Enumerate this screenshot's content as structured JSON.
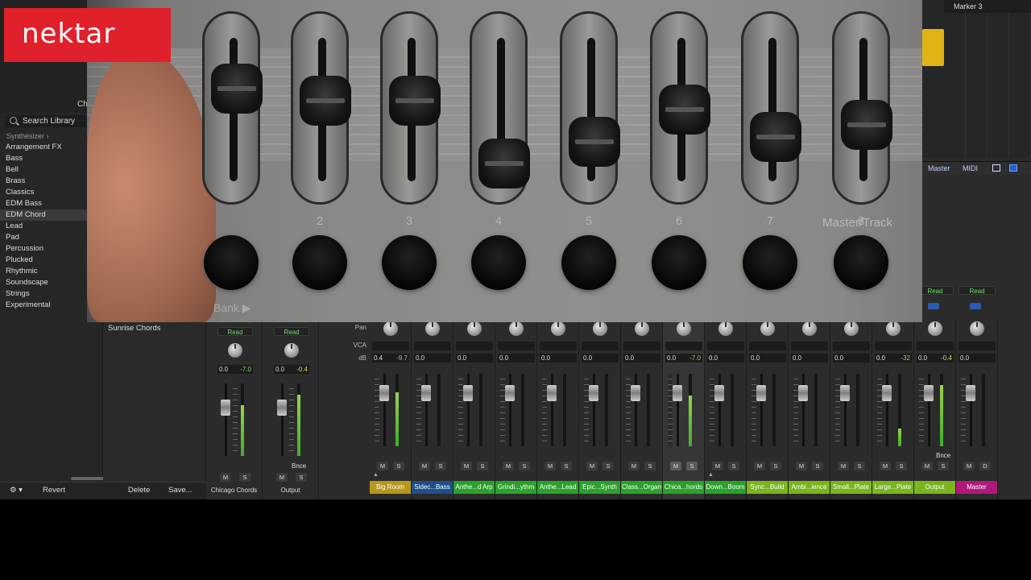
{
  "brand": {
    "logo_text": "nektar",
    "color": "#e0202a"
  },
  "library": {
    "title_clip": "Chi",
    "search_placeholder": "Search Library",
    "breadcrumb": "Synthesizer",
    "items": [
      "Arrangement FX",
      "Bass",
      "Bell",
      "Brass",
      "Classics",
      "EDM Bass",
      "EDM Chord",
      "Lead",
      "Pad",
      "Percussion",
      "Plucked",
      "Rhythmic",
      "Soundscape",
      "Strings",
      "Experimental"
    ],
    "selected": "EDM Chord",
    "footer": {
      "revert": "Revert",
      "delete": "Delete",
      "save": "Save..."
    }
  },
  "patches": {
    "current": "Sunrise Chords"
  },
  "tracks": {
    "marker": "Marker 3"
  },
  "mixer_toolbar": {
    "master": "Master",
    "midi": "MIDI"
  },
  "hardware": {
    "fader_numbers": [
      "2",
      "3",
      "4",
      "5",
      "6",
      "7",
      "8"
    ],
    "master_label": "Master/Track",
    "bank_label": "Bank ▶",
    "fader_levels": [
      0.72,
      0.62,
      0.62,
      0.1,
      0.28,
      0.55,
      0.32,
      0.42
    ]
  },
  "mixer": {
    "row_labels": {
      "pan": "Pan",
      "vca": "VCA",
      "db": "dB"
    },
    "left_strips": [
      {
        "name": "Chicago Chords",
        "auto": "Read",
        "vol": "0.0",
        "peak": "-7.0",
        "peak_kind": "hot",
        "m": "M",
        "s": "S",
        "meter": 0.7
      },
      {
        "name": "Output",
        "auto": "Read",
        "vol": "0.0",
        "peak": "-0.4",
        "peak_kind": "warn",
        "m": "M",
        "s": "S",
        "bnce": "Bnce",
        "meter": 0.85
      }
    ],
    "strips": [
      {
        "name": "Big Room",
        "color": "#b8971a",
        "vol": "0.4",
        "peak": "-9.7",
        "peak_kind": "hot",
        "meter": 0.75
      },
      {
        "name": "Sidec...Bass",
        "color": "#1f4f8a",
        "vol": "0.0",
        "peak": "",
        "peak_kind": "",
        "meter": 0
      },
      {
        "name": "Anthe...d Arp",
        "color": "#2aa12a",
        "vol": "0.0",
        "peak": "",
        "peak_kind": "",
        "meter": 0
      },
      {
        "name": "Grindi...ythm",
        "color": "#2aa12a",
        "vol": "0.0",
        "peak": "",
        "peak_kind": "",
        "meter": 0
      },
      {
        "name": "Anthe...Lead",
        "color": "#2aa12a",
        "vol": "0.0",
        "peak": "",
        "peak_kind": "",
        "meter": 0
      },
      {
        "name": "Epic...Synth",
        "color": "#2aa12a",
        "vol": "0.0",
        "peak": "",
        "peak_kind": "",
        "meter": 0
      },
      {
        "name": "Class...Organ",
        "color": "#2aa12a",
        "vol": "0.0",
        "peak": "",
        "peak_kind": "",
        "meter": 0
      },
      {
        "name": "Chica...hords",
        "color": "#2aa12a",
        "vol": "0.0",
        "peak": "-7.0",
        "peak_kind": "hot",
        "meter": 0.7,
        "selected": true
      },
      {
        "name": "Down...Boom",
        "color": "#2aa12a",
        "vol": "0.0",
        "peak": "",
        "peak_kind": "",
        "meter": 0
      },
      {
        "name": "Sync...Build",
        "color": "#7ab51d",
        "vol": "0.0",
        "peak": "",
        "peak_kind": "",
        "meter": 0
      },
      {
        "name": "Ambi...ience",
        "color": "#7ab51d",
        "vol": "0.0",
        "peak": "",
        "peak_kind": "",
        "meter": 0
      },
      {
        "name": "Small...Plate",
        "color": "#7ab51d",
        "vol": "0.0",
        "peak": "",
        "peak_kind": "",
        "meter": 0
      },
      {
        "name": "Large...Plate",
        "color": "#7ab51d",
        "vol": "0.0",
        "peak": "-32",
        "peak_kind": "hot",
        "meter": 0.25
      },
      {
        "name": "Output",
        "color": "#7ab51d",
        "vol": "0.0",
        "peak": "-0.4",
        "peak_kind": "warn",
        "meter": 0.85,
        "auto": "Read",
        "bnce": "Bnce"
      },
      {
        "name": "Master",
        "color": "#b0197a",
        "vol": "0.0",
        "peak": "",
        "peak_kind": "",
        "meter": 0,
        "auto": "Read",
        "second_btn": "D"
      }
    ]
  }
}
